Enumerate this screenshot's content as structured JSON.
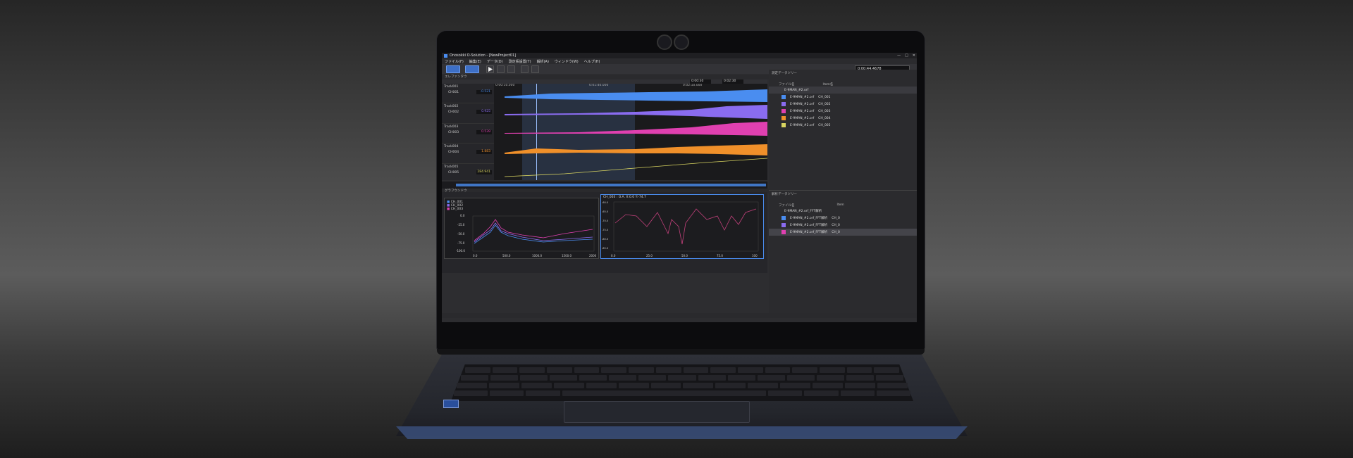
{
  "app": {
    "title": "Onosokki O-Solution - [NewProject01]",
    "menu": [
      "ファイル(F)",
      "編集(E)",
      "データ(D)",
      "測定系設置(T)",
      "解析(A)",
      "ウィンドウ(W)",
      "ヘルプ(H)"
    ],
    "time_display": "0:00:44.4678",
    "window_controls": [
      "—",
      "□",
      "✕"
    ]
  },
  "waveform_pane": {
    "tab": "エレファンタウ",
    "range_start": "0:00:30",
    "range_end": "0:02:30",
    "time_ticks": [
      "0:00:10.000",
      "0:01:40.000",
      "0:02:10.000"
    ],
    "tracks": [
      {
        "track": "Track001",
        "channel": "CH001",
        "value": "-0.521",
        "color": "#4a8df0",
        "scale_top": "18.000",
        "scale_bottom": "-18.000"
      },
      {
        "track": "Track002",
        "channel": "CH002",
        "value": "0.925",
        "color": "#8a6cf0",
        "scale_top": "22.000",
        "scale_bottom": "-22.000"
      },
      {
        "track": "Track003",
        "channel": "CH003",
        "value": "0.539",
        "color": "#e040b0",
        "scale_top": "32.000",
        "scale_bottom": "-32.000"
      },
      {
        "track": "Track004",
        "channel": "CH004",
        "value": "1.883",
        "color": "#f0902a",
        "scale_top": "40.000",
        "scale_bottom": "-16.000"
      },
      {
        "track": "Track005",
        "channel": "CH005",
        "value": "284.941",
        "color": "#d8d460",
        "scale_top": "3000.000",
        "scale_bottom": "0.000"
      }
    ]
  },
  "graph_pane": {
    "tab": "グラフウンドウ",
    "legend": [
      {
        "name": "CH_001",
        "color": "#4a8df0"
      },
      {
        "name": "CH_002",
        "color": "#8a6cf0"
      },
      {
        "name": "CH_003",
        "color": "#e040b0"
      }
    ],
    "left_y_ticks": [
      "0.0",
      "-25.0",
      "-50.0",
      "-75.0",
      "-100.0"
    ],
    "left_x_ticks": [
      "0.0",
      "500.0",
      "1000.0",
      "1500.0",
      "2000"
    ],
    "right_title": "CH_003 : O.A. X:0.0 Y:-74.7",
    "right_y_ticks": [
      "-60.0",
      "-65.0",
      "-70.0",
      "-75.0",
      "-80.0",
      "-85.0"
    ],
    "right_x_ticks": [
      "0.0",
      "25.0",
      "50.0",
      "75.0",
      "100"
    ]
  },
  "data_tree_top": {
    "header": "測定データツリー",
    "col_file": "ファイル名",
    "col_item": "Item名",
    "root": "E-9MAN_#2.orf",
    "items": [
      {
        "file": "E-9MAN_#2.orf",
        "channel": "CH_001",
        "color": "#4a8df0"
      },
      {
        "file": "E-9MAN_#2.orf",
        "channel": "CH_002",
        "color": "#8a6cf0"
      },
      {
        "file": "E-9MAN_#2.orf",
        "channel": "CH_003",
        "color": "#e040b0"
      },
      {
        "file": "E-9MAN_#2.orf",
        "channel": "CH_004",
        "color": "#f0902a"
      },
      {
        "file": "E-9MAN_#2.orf",
        "channel": "CH_005",
        "color": "#d8d460"
      }
    ]
  },
  "data_tree_bottom": {
    "header": "解析データツリー",
    "col_file": "ファイル名",
    "col_item": "Item",
    "root": "E-9MAN_#2.orf_FFT解析",
    "items": [
      {
        "file": "E-9MAN_#2.orf_FFT解析",
        "channel": "CH_0",
        "color": "#4a8df0"
      },
      {
        "file": "E-9MAN_#2.orf_FFT解析",
        "channel": "CH_0",
        "color": "#8a6cf0"
      },
      {
        "file": "E-9MAN_#2.orf_FFT解析",
        "channel": "CH_0",
        "color": "#e040b0"
      }
    ]
  }
}
